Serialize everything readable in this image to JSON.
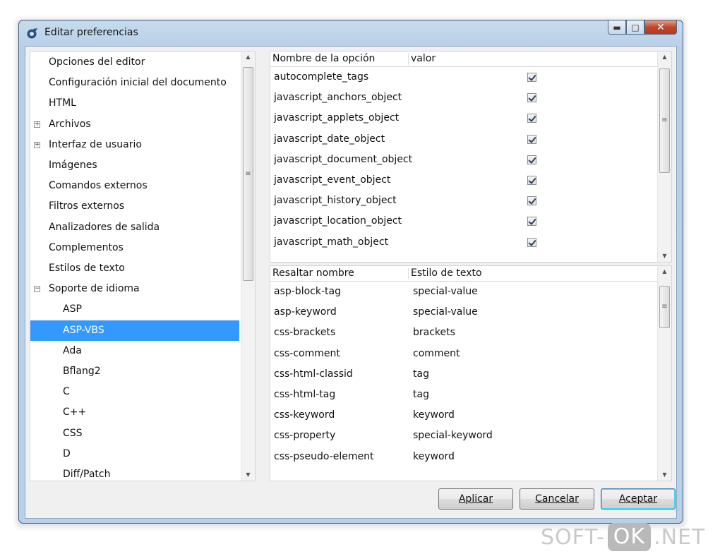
{
  "window": {
    "title": "Editar preferencias"
  },
  "tree": {
    "items": [
      {
        "label": "Opciones del editor",
        "level": 0,
        "expander": ""
      },
      {
        "label": "Configuración inicial del documento",
        "level": 0,
        "expander": ""
      },
      {
        "label": "HTML",
        "level": 0,
        "expander": ""
      },
      {
        "label": "Archivos",
        "level": 0,
        "expander": "+"
      },
      {
        "label": "Interfaz de usuario",
        "level": 0,
        "expander": "+"
      },
      {
        "label": "Imágenes",
        "level": 0,
        "expander": ""
      },
      {
        "label": "Comandos externos",
        "level": 0,
        "expander": ""
      },
      {
        "label": "Filtros externos",
        "level": 0,
        "expander": ""
      },
      {
        "label": "Analizadores de salida",
        "level": 0,
        "expander": ""
      },
      {
        "label": "Complementos",
        "level": 0,
        "expander": ""
      },
      {
        "label": "Estilos de texto",
        "level": 0,
        "expander": ""
      },
      {
        "label": "Soporte de idioma",
        "level": 0,
        "expander": "−"
      },
      {
        "label": "ASP",
        "level": 1,
        "expander": ""
      },
      {
        "label": "ASP-VBS",
        "level": 1,
        "expander": "",
        "selected": true
      },
      {
        "label": "Ada",
        "level": 1,
        "expander": ""
      },
      {
        "label": "Bflang2",
        "level": 1,
        "expander": ""
      },
      {
        "label": "C",
        "level": 1,
        "expander": ""
      },
      {
        "label": "C++",
        "level": 1,
        "expander": ""
      },
      {
        "label": "CSS",
        "level": 1,
        "expander": ""
      },
      {
        "label": "D",
        "level": 1,
        "expander": ""
      },
      {
        "label": "Diff/Patch",
        "level": 1,
        "expander": ""
      }
    ]
  },
  "options_table": {
    "col_name": "Nombre de la opción",
    "col_value": "valor",
    "rows": [
      {
        "name": "autocomplete_tags",
        "checked": true
      },
      {
        "name": "javascript_anchors_object",
        "checked": true
      },
      {
        "name": "javascript_applets_object",
        "checked": true
      },
      {
        "name": "javascript_date_object",
        "checked": true
      },
      {
        "name": "javascript_document_object",
        "checked": true
      },
      {
        "name": "javascript_event_object",
        "checked": true
      },
      {
        "name": "javascript_history_object",
        "checked": true
      },
      {
        "name": "javascript_location_object",
        "checked": true
      },
      {
        "name": "javascript_math_object",
        "checked": true
      }
    ]
  },
  "highlight_table": {
    "col_name": "Resaltar nombre",
    "col_style": "Estilo de texto",
    "rows": [
      {
        "name": "asp-block-tag",
        "style": "special-value"
      },
      {
        "name": "asp-keyword",
        "style": "special-value"
      },
      {
        "name": "css-brackets",
        "style": "brackets"
      },
      {
        "name": "css-comment",
        "style": "comment"
      },
      {
        "name": "css-html-classid",
        "style": "tag"
      },
      {
        "name": "css-html-tag",
        "style": "tag"
      },
      {
        "name": "css-keyword",
        "style": "keyword"
      },
      {
        "name": "css-property",
        "style": "special-keyword"
      },
      {
        "name": "css-pseudo-element",
        "style": "keyword"
      }
    ]
  },
  "buttons": {
    "apply": "Aplicar",
    "cancel": "Cancelar",
    "accept": "Aceptar"
  },
  "watermark": {
    "left": "SOFT-",
    "middle": "OK",
    "right": ".NET"
  }
}
